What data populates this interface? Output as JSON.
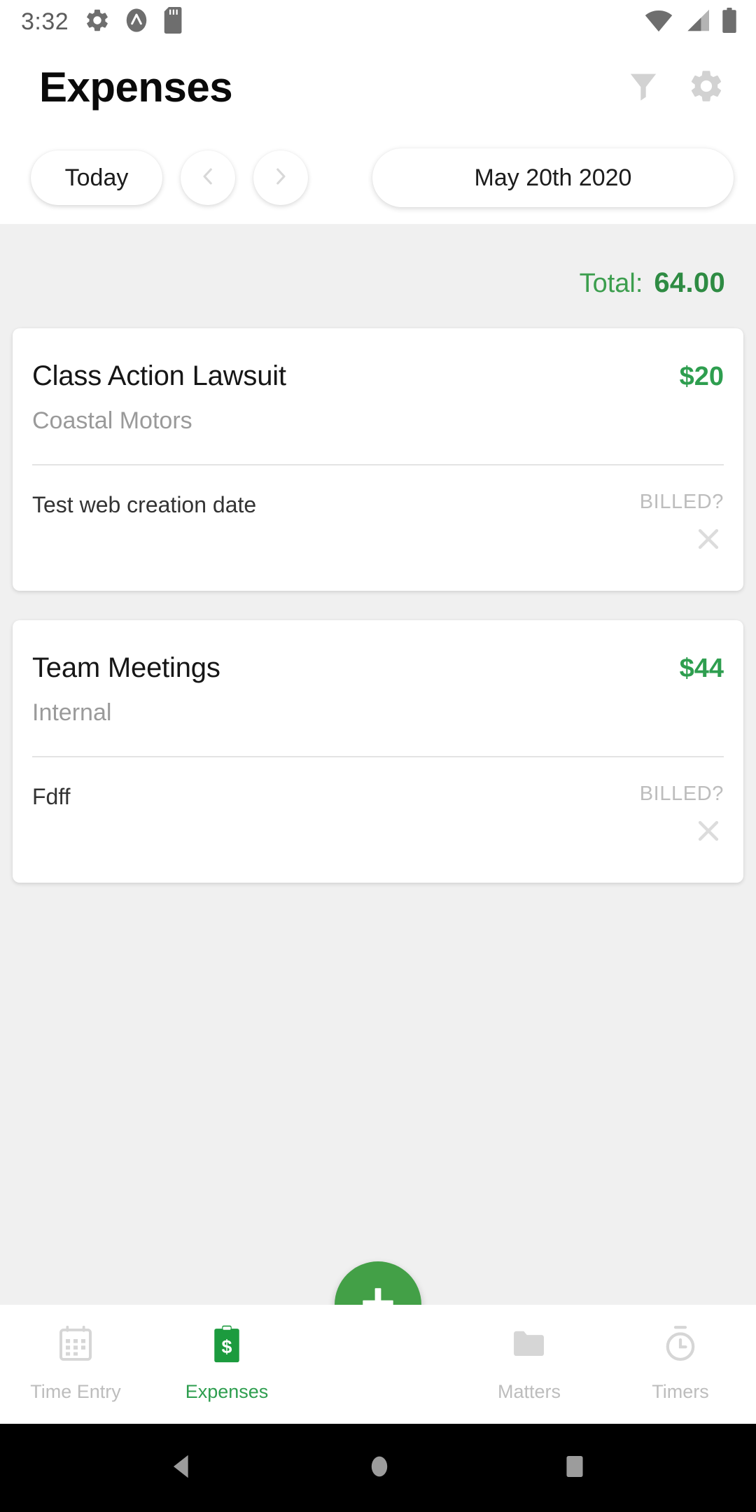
{
  "statusbar": {
    "time": "3:32",
    "left_icons": [
      "gear-icon",
      "app-logo-icon",
      "sd-card-icon"
    ],
    "right_icons": [
      "wifi-icon",
      "cellular-signal-icon",
      "battery-icon"
    ]
  },
  "appbar": {
    "title": "Expenses",
    "actions": [
      {
        "name": "filter-icon"
      },
      {
        "name": "settings-gear-icon"
      }
    ]
  },
  "datebar": {
    "today_label": "Today",
    "prev_icon": "chevron-left-icon",
    "next_icon": "chevron-right-icon",
    "current_date": "May 20th 2020"
  },
  "summary": {
    "total_label": "Total:",
    "total_value": "64.00"
  },
  "expenses": [
    {
      "title": "Class Action Lawsuit",
      "client": "Coastal Motors",
      "amount": "$20",
      "description": "Test web creation date",
      "billed_label": "BILLED?",
      "billed_state": "x-mark-icon"
    },
    {
      "title": "Team Meetings",
      "client": "Internal",
      "amount": "$44",
      "description": "Fdff",
      "billed_label": "BILLED?",
      "billed_state": "x-mark-icon"
    }
  ],
  "fab": {
    "icon": "plus-icon",
    "label": "Add expense"
  },
  "bottomnav": {
    "items": [
      {
        "label": "Time Entry",
        "icon": "calendar-icon",
        "active": false
      },
      {
        "label": "Expenses",
        "icon": "clipboard-dollar-icon",
        "active": true
      },
      {
        "label": "Matters",
        "icon": "folder-icon",
        "active": false
      },
      {
        "label": "Timers",
        "icon": "stopwatch-icon",
        "active": false
      }
    ]
  },
  "androidnav": {
    "back": "back-triangle-icon",
    "home": "home-circle-icon",
    "recents": "recents-square-icon"
  },
  "colors": {
    "green": "#2e9e4f",
    "green_fab": "#43a047",
    "gray_bg": "#f0f0f0",
    "muted": "#bdbdbd"
  }
}
